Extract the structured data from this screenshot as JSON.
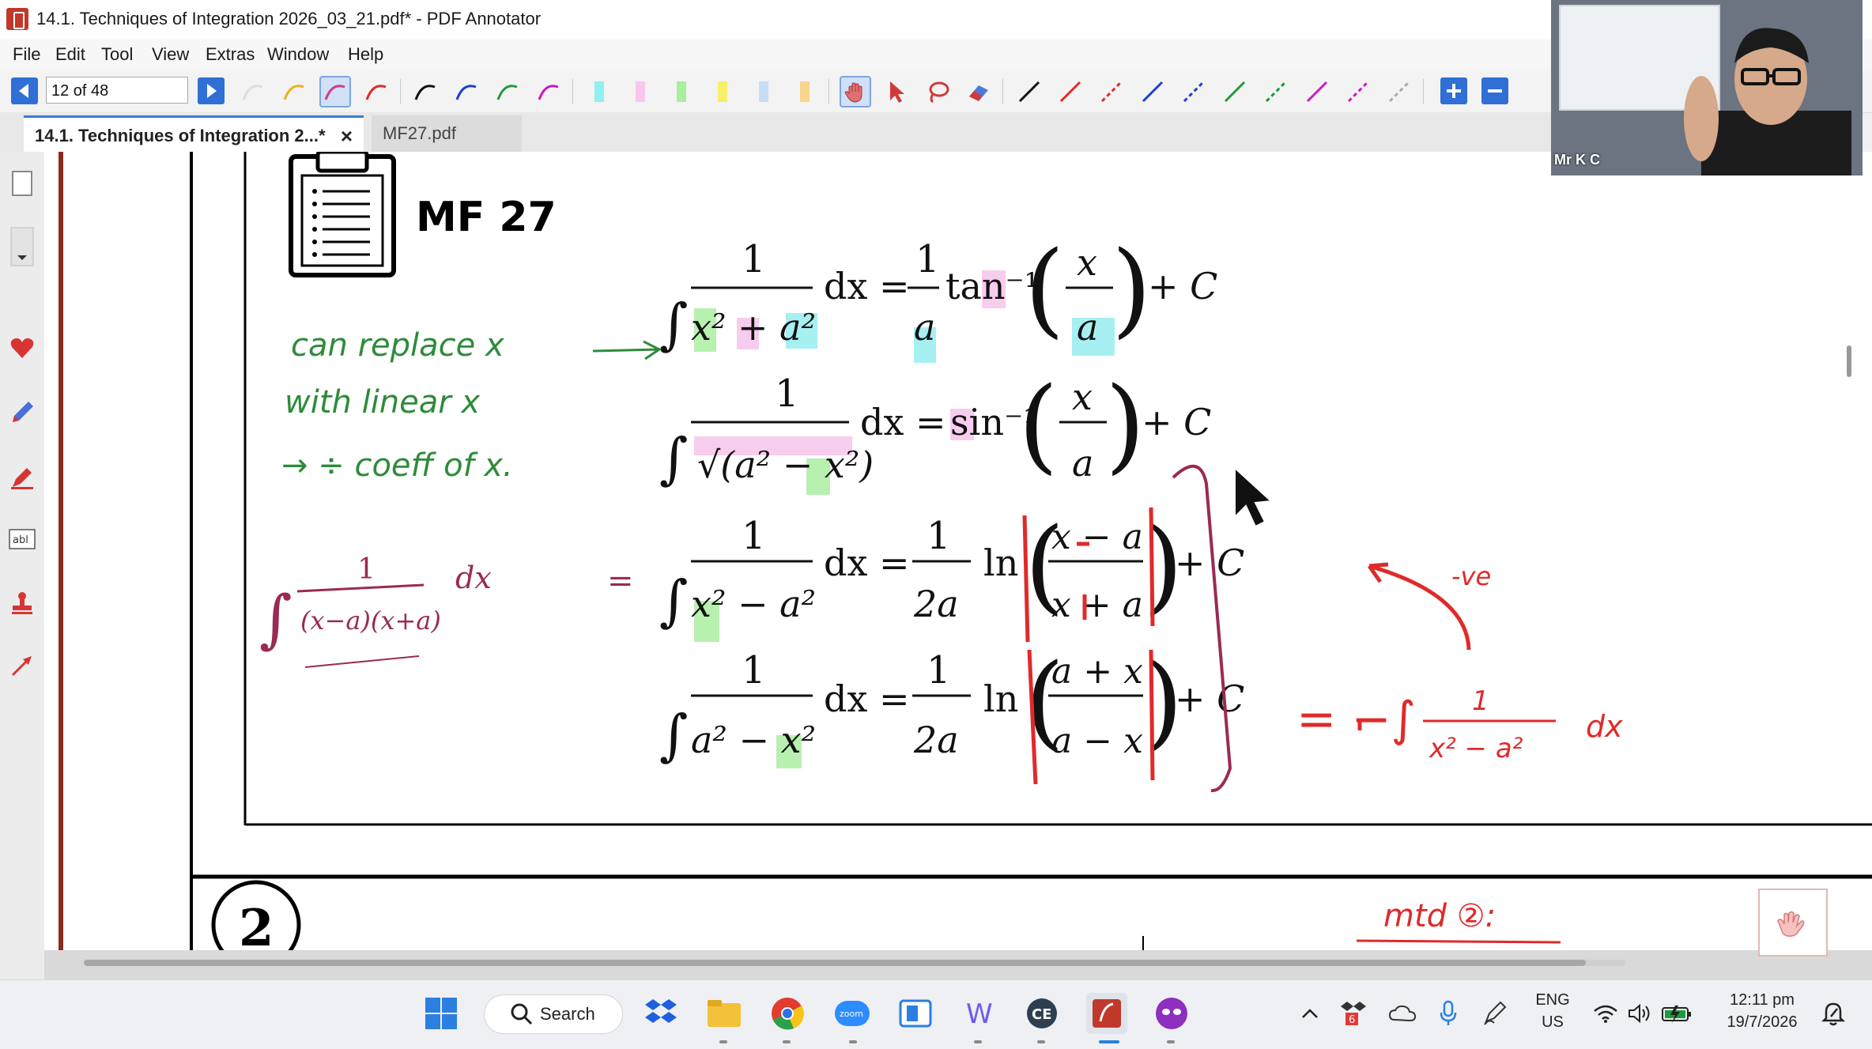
{
  "window": {
    "title": "14.1. Techniques of Integration 2026_03_21.pdf* - PDF Annotator"
  },
  "menu": [
    "File",
    "Edit",
    "Tool",
    "View",
    "Extras",
    "Window",
    "Help"
  ],
  "toolbar": {
    "page_indicator": "12 of 48"
  },
  "tabs": [
    {
      "label": "14.1. Techniques of Integration 2...*",
      "active": true
    },
    {
      "label": "MF27.pdf",
      "active": false
    }
  ],
  "tab_close_glyph": "×",
  "document": {
    "heading": "MF 27",
    "formulas": [
      {
        "lhs_num": "1",
        "lhs_den": "x² + a²",
        "rhs_coef_num": "1",
        "rhs_coef_den": "a",
        "func": "tan⁻¹",
        "arg_num": "x",
        "arg_den": "a"
      },
      {
        "lhs_num": "1",
        "lhs_den": "√(a² − x²)",
        "func": "sin⁻¹",
        "arg_num": "x",
        "arg_den": "a"
      },
      {
        "lhs_num": "1",
        "lhs_den": "x² − a²",
        "rhs_coef_num": "1",
        "rhs_coef_den": "2a",
        "func": "ln",
        "arg_num": "x − a",
        "arg_den": "x + a"
      },
      {
        "lhs_num": "1",
        "lhs_den": "a² − x²",
        "rhs_coef_num": "1",
        "rhs_coef_den": "2a",
        "func": "ln",
        "arg_num": "a + x",
        "arg_den": "a − x"
      }
    ],
    "handwritten_green": [
      "can replace x",
      "with linear x",
      "→ ÷ coeff of x."
    ],
    "handwritten_red": [
      "-ve",
      "= −∫",
      "1",
      "x² − a²",
      "dx",
      "mtd ②:"
    ],
    "handwritten_purple": [
      "∫",
      "1",
      "(x−a)(x+a)",
      "dx",
      "="
    ],
    "next_section_number": "2"
  },
  "webcam": {
    "name": "Mr K C"
  },
  "taskbar": {
    "search_label": "Search",
    "language_line1": "ENG",
    "language_line2": "US",
    "time": "12:11 pm",
    "date": "19/7/2026",
    "badge_count": "6"
  },
  "colors": {
    "accent": "#2f6fd6",
    "ink_green": "#2e8b3a",
    "ink_red": "#e02a2a",
    "ink_purple": "#9a2a55",
    "highlight_green": "#b8f0b0",
    "highlight_pink": "#f7cdee",
    "highlight_cyan": "#a6f0f2"
  }
}
